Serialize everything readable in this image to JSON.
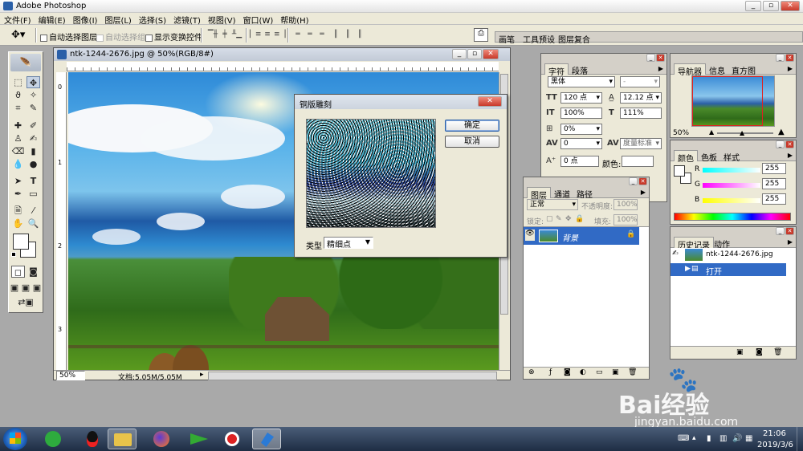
{
  "app": {
    "title": "Adobe Photoshop"
  },
  "menu": [
    "文件(F)",
    "编辑(E)",
    "图像(I)",
    "图层(L)",
    "选择(S)",
    "滤镜(T)",
    "视图(V)",
    "窗口(W)",
    "帮助(H)"
  ],
  "options": {
    "auto_select_layer": "自动选择图层",
    "auto_select_group": "自动选择组",
    "show_transform": "显示变换控件",
    "wells": [
      "画笔",
      "工具预设",
      "图层复合"
    ]
  },
  "document": {
    "title": "ntk-1244-2676.jpg @ 50%(RGB/8#)",
    "zoom": "50%",
    "doc_info": "文档:5.05M/5.05M",
    "ruler_v": [
      "0",
      "1",
      "2",
      "3"
    ]
  },
  "dialog": {
    "title": "铜版雕刻",
    "ok": "确定",
    "cancel": "取消",
    "type_label": "类型",
    "type_value": "精细点"
  },
  "character_panel": {
    "tabs": [
      "字符",
      "段落"
    ],
    "font": "黑体",
    "style": "-",
    "size": "120 点",
    "leading": "12.12 点",
    "v_scale": "100%",
    "h_scale": "111%",
    "baseline": "0%",
    "tracking": "0",
    "kerning": "度量标准",
    "shift": "0 点",
    "color_label": "颜色:"
  },
  "layers_panel": {
    "tabs": [
      "图层",
      "通道",
      "路径"
    ],
    "blend": "正常",
    "opacity_label": "不透明度:",
    "opacity": "100%",
    "lock_label": "锁定:",
    "fill_label": "填充:",
    "fill": "100%",
    "layer_name": "背景"
  },
  "navigator_panel": {
    "tabs": [
      "导航器",
      "信息",
      "直方图"
    ],
    "zoom": "50%"
  },
  "color_panel": {
    "tabs": [
      "颜色",
      "色板",
      "样式"
    ],
    "channels": [
      {
        "label": "R",
        "value": "255"
      },
      {
        "label": "G",
        "value": "255"
      },
      {
        "label": "B",
        "value": "255"
      }
    ]
  },
  "history_panel": {
    "tabs": [
      "历史记录",
      "动作"
    ],
    "snapshot": "ntk-1244-2676.jpg",
    "step": "打开"
  },
  "watermark": {
    "brand": "Bai经验",
    "url": "jingyan.baidu.com"
  },
  "taskbar": {
    "time": "21:06",
    "date": "2019/3/6"
  }
}
